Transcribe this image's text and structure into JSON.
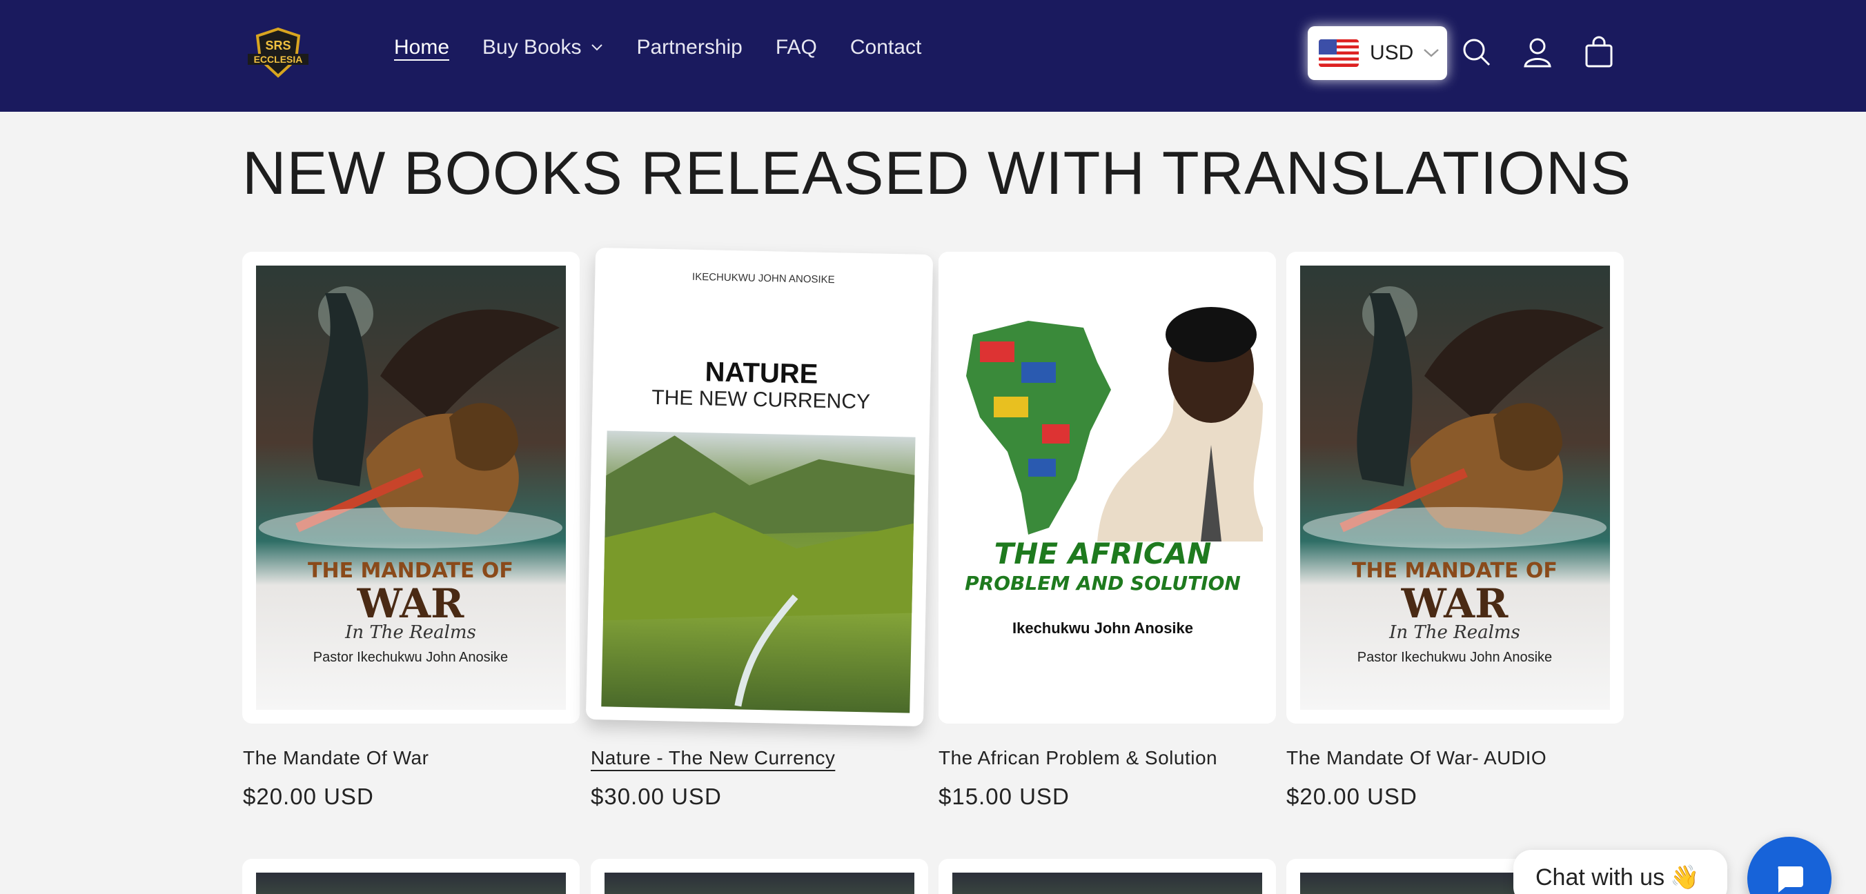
{
  "header": {
    "logo_text": "ECCLESIA",
    "nav": [
      {
        "label": "Home"
      },
      {
        "label": "Buy Books"
      },
      {
        "label": "Partnership"
      },
      {
        "label": "FAQ"
      },
      {
        "label": "Contact"
      }
    ],
    "currency": "USD",
    "icons": [
      "search-icon",
      "account-icon",
      "cart-icon"
    ]
  },
  "section": {
    "title": "NEW BOOKS RELEASED WITH TRANSLATIONS"
  },
  "products": [
    {
      "title": "The Mandate Of War",
      "price": "$20.00 USD",
      "cover": {
        "line1": "THE MANDATE OF",
        "line2": "WAR",
        "line3": "In The Realms",
        "author": "Pastor Ikechukwu John Anosike"
      }
    },
    {
      "title": "Nature - The New Currency",
      "price": "$30.00 USD",
      "cover": {
        "author": "IKECHUKWU JOHN ANOSIKE",
        "line1": "NATURE",
        "line2": "THE NEW CURRENCY"
      }
    },
    {
      "title": "The African Problem & Solution",
      "price": "$15.00 USD",
      "cover": {
        "line1": "THE AFRICAN",
        "line2": "PROBLEM AND SOLUTION",
        "author": "Ikechukwu John Anosike"
      }
    },
    {
      "title": "The Mandate Of War- AUDIO",
      "price": "$20.00 USD",
      "cover": {
        "line1": "THE MANDATE OF",
        "line2": "WAR",
        "line3": "In The Realms",
        "author": "Pastor Ikechukwu John Anosike"
      }
    }
  ],
  "chat": {
    "label": "Chat with us",
    "emoji": "👋"
  },
  "colors": {
    "header_bg": "#1a1a5e",
    "page_bg": "#f3f3f3",
    "chat_button": "#1763d9",
    "african_title_green": "#1e7a1e"
  }
}
